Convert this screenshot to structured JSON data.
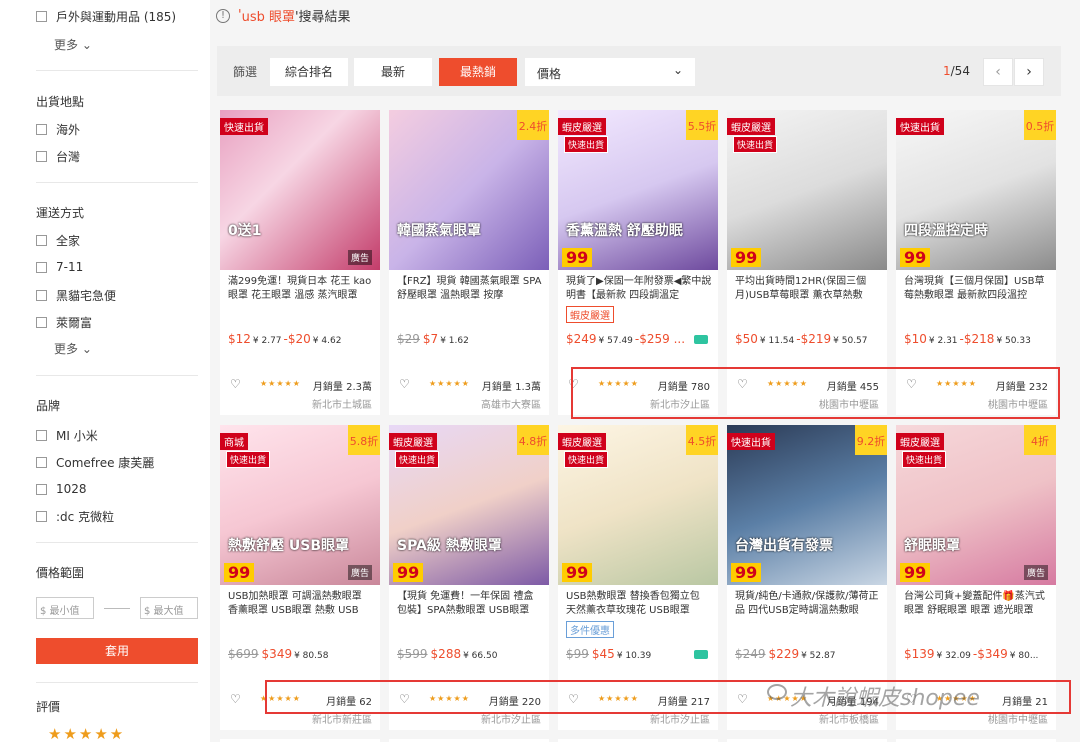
{
  "sidebar": {
    "outdoor": {
      "label": "戶外與運動用品 (185)"
    },
    "more1": "更多 ⌄",
    "ship_from": {
      "title": "出貨地點",
      "items": [
        "海外",
        "台灣"
      ]
    },
    "delivery": {
      "title": "運送方式",
      "items": [
        "全家",
        "7-11",
        "黑貓宅急便",
        "萊爾富"
      ]
    },
    "more2": "更多 ⌄",
    "brand": {
      "title": "品牌",
      "items": [
        "MI 小米",
        "Comefree 康芙麗",
        "1028",
        ":dc 克微粒"
      ]
    },
    "price_range": {
      "title": "價格範圍",
      "min_placeholder": "$ 最小值",
      "max_placeholder": "$ 最大值",
      "apply": "套用"
    },
    "rating": {
      "title": "評價",
      "stars": "★★★★★"
    }
  },
  "search_hint": {
    "prefix": "'",
    "keyword": "usb 眼罩",
    "suffix": "'搜尋結果"
  },
  "sortbar": {
    "label": "篩選",
    "buttons": [
      "綜合排名",
      "最新",
      "最熱銷"
    ],
    "price_select": "價格",
    "page_current": "1",
    "page_total": "/54",
    "prev": "‹",
    "next": "›"
  },
  "products": [
    {
      "title": "滿299免運！現貨日本 花王 kao 眼罩 花王眼罩 溫感 蒸汽眼罩",
      "badge": "快速出貨",
      "overlay": "0送1",
      "ad": "廣告",
      "price_html": "$12|¥2.77|-|$20|¥4.62",
      "sold": "月銷量 2.3萬",
      "loc": "新北市土城區",
      "rating": "★★★★★"
    },
    {
      "title": "【FRZ】現貨 韓國蒸氣眼罩 SPA舒壓眼罩 溫熱眼罩 按摩",
      "disc": "2.4折",
      "overlay": "韓國蒸氣眼罩",
      "old": "$29",
      "price_html": "$7|¥1.62",
      "sold": "月銷量 1.3萬",
      "loc": "高雄市大寮區",
      "rating": "★★★★★"
    },
    {
      "title": "現貨了▶保固一年附發票◀繁中說明書【最新款 四段調溫定",
      "badge": "蝦皮嚴選",
      "badge2": "快速出貨",
      "disc": "5.5折",
      "tag": "蝦皮嚴選",
      "overlay": "香薰溫熱 舒壓助眠",
      "tag99": "99",
      "price_html": "$249|¥57.49|-|$259 ...",
      "sold": "月銷量 780",
      "loc": "新北市汐止區",
      "rating": "★★★★★"
    },
    {
      "title": "平均出貨時間12HR(保固三個月)USB草莓眼罩 薰衣草熱敷",
      "badge": "蝦皮嚴選",
      "badge2": "快速出貨",
      "tag99": "99",
      "price_html": "$50|¥11.54|-|$219|¥50.57",
      "sold": "月銷量 455",
      "loc": "桃園市中壢區",
      "rating": "★★★★★"
    },
    {
      "title": "台灣現貨【三個月保固】USB草莓熱敷眼罩 最新款四段溫控",
      "badge": "快速出貨",
      "disc": "0.5折",
      "overlay": "四段溫控定時",
      "tag99": "99",
      "price_html": "$10|¥2.31|-|$218|¥50.33",
      "sold": "月銷量 232",
      "loc": "桃園市中壢區",
      "rating": "★★★★★"
    },
    {
      "title": "USB加熱眼罩 可調溫熱敷眼罩 香薰眼罩 USB眼罩 熱敷 USB",
      "badge": "商城",
      "badge2": "快速出貨",
      "disc": "5.8折",
      "overlay": "熱敷舒壓 USB眼罩",
      "tag99": "99",
      "ad": "廣告",
      "old": "$699",
      "price_html": "$349|¥80.58",
      "sold": "月銷量 62",
      "loc": "新北市新莊區",
      "rating": "★★★★★"
    },
    {
      "title": "【現貨 免運費！一年保固 禮盒包裝】SPA熱敷眼罩 USB眼罩",
      "badge": "蝦皮嚴選",
      "badge2": "快速出貨",
      "disc": "4.8折",
      "overlay": "SPA級 熱敷眼罩",
      "tag99": "99",
      "old": "$599",
      "price_html": "$288|¥66.50",
      "sold": "月銷量 220",
      "loc": "新北市汐止區",
      "rating": "★★★★★"
    },
    {
      "title": "USB熱敷眼罩 替換香包獨立包 天然薰衣草玫瑰花 USB眼罩",
      "badge": "蝦皮嚴選",
      "badge2": "快速出貨",
      "disc": "4.5折",
      "tag": "多件優惠",
      "tagblue": true,
      "tag99": "99",
      "old": "$99",
      "price_html": "$45|¥10.39",
      "sold": "月銷量 217",
      "loc": "新北市汐止區",
      "rating": "★★★★★"
    },
    {
      "title": "現貨/純色/卡通款/保護款/薄荷正品 四代USB定時調溫熱敷眼",
      "badge": "快速出貨",
      "disc": "9.2折",
      "overlay": "台灣出貨有發票",
      "tag99": "99",
      "old": "$249",
      "price_html": "$229|¥52.87",
      "sold": "月銷量 194",
      "loc": "新北市板橋區",
      "rating": "★★★★★"
    },
    {
      "title": "台灣公司貨+變蓋配件🎁蒸汽式眼罩 舒眠眼罩 眼罩 遮光眼罩",
      "badge": "蝦皮嚴選",
      "badge2": "快速出貨",
      "disc": "4折",
      "overlay": "舒眠眼罩",
      "tag99": "99",
      "ad": "廣告",
      "price_html": "$139|¥32.09|-|$349|¥80...",
      "sold": "月銷量 21",
      "loc": "桃園市中壢區",
      "rating": "★★★★★"
    }
  ],
  "watermark": "大木說蝦皮shopee"
}
